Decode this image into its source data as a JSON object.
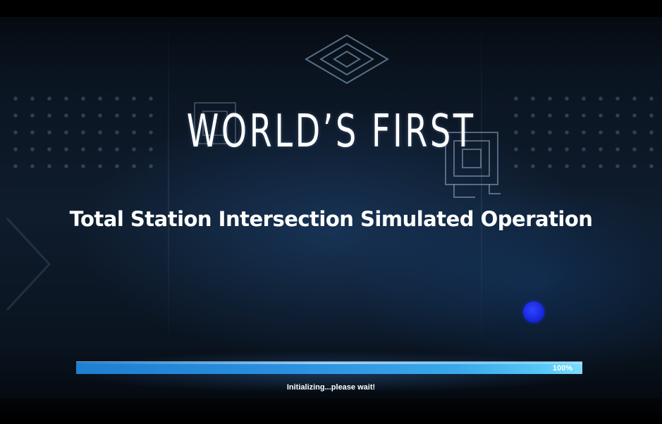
{
  "loading_screen": {
    "title": "WORLD’S FIRST",
    "subtitle": "Total Station Intersection Simulated Operation",
    "progress": {
      "percent_label": "100%",
      "value": 1.0
    },
    "status": "Initializing...please wait!"
  },
  "colors": {
    "background": "#0f1c2c",
    "progress_fill": "#2a8fde",
    "progress_track": "#1a3f63",
    "indicator_dot": "#1a2bf0",
    "text": "#ffffff"
  },
  "icons": {
    "indicator": "blue-dot-icon",
    "decor_top": "nested-diamond-icon",
    "decor_right": "nested-square-circuit-icon"
  }
}
